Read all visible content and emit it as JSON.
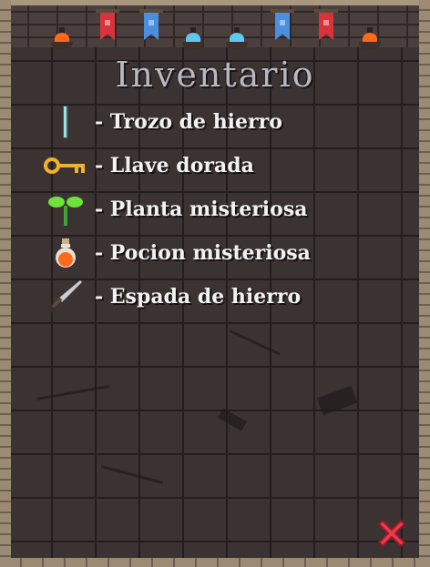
{
  "inventory": {
    "title": "Inventario",
    "items": [
      {
        "label": "- Trozo de hierro",
        "icon": "iron-shard-icon"
      },
      {
        "label": "- Llave dorada",
        "icon": "golden-key-icon"
      },
      {
        "label": "- Planta misteriosa",
        "icon": "plant-sprout-icon"
      },
      {
        "label": "- Pocion misteriosa",
        "icon": "potion-icon"
      },
      {
        "label": "- Espada de hierro",
        "icon": "iron-sword-icon"
      }
    ]
  },
  "controls": {
    "close_icon": "close-x-icon"
  },
  "colors": {
    "banner_red": "#d8323a",
    "banner_blue": "#4a8fe0",
    "flame_orange": "#ff6a1a",
    "flame_blue": "#5ec8f2",
    "close_red": "#e83a4a"
  }
}
